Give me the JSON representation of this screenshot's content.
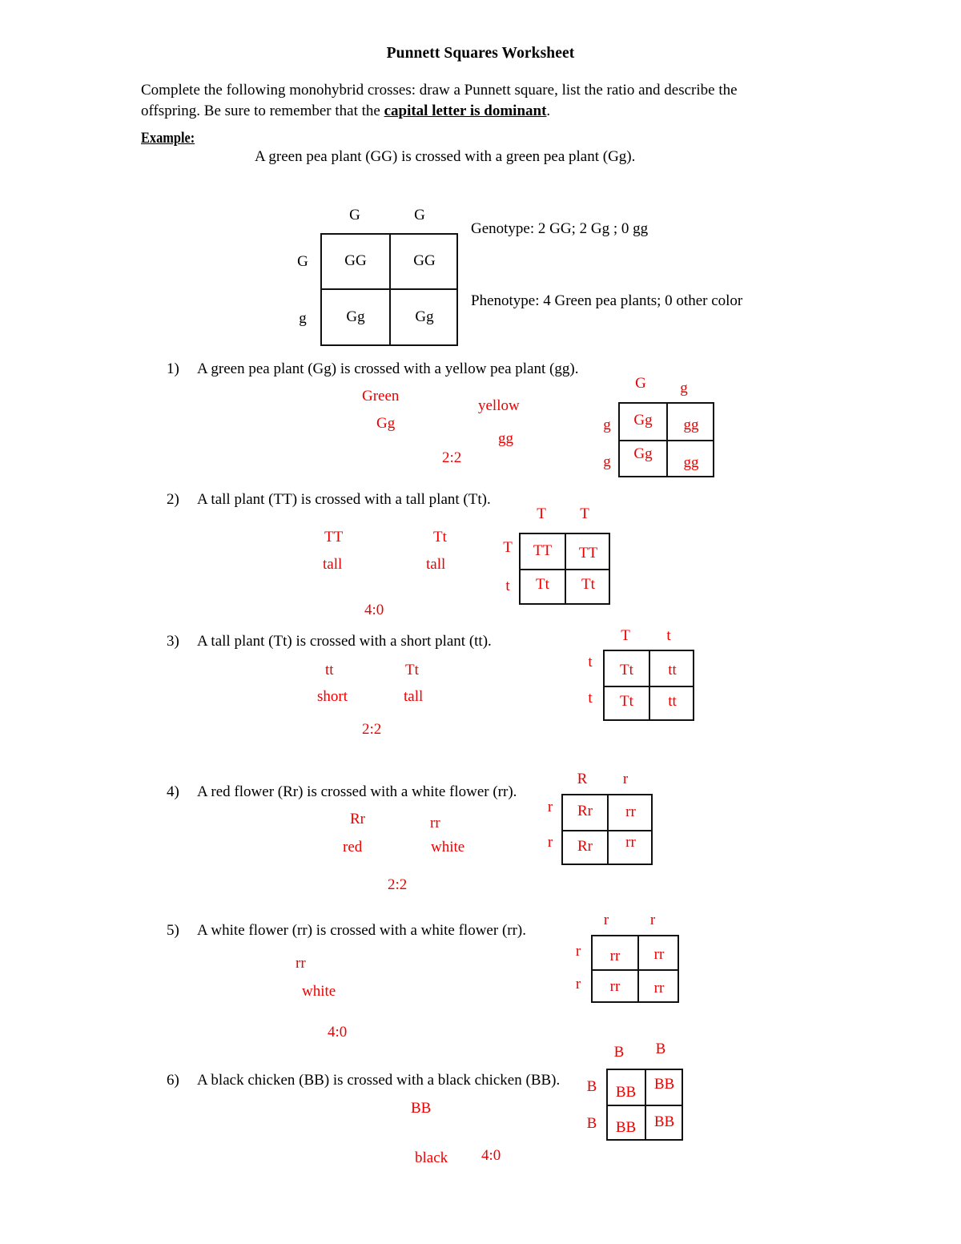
{
  "document": {
    "title": "Punnett Squares Worksheet",
    "instructions_part1": "Complete the following monohybrid crosses:  draw a Punnett square, list the ratio and describe the offspring.  Be sure to remember that the ",
    "instructions_bold": "capital letter is dominant",
    "instructions_part3": ".",
    "example_label": "Example:",
    "example_prompt": "A green pea plant (GG) is crossed with a green pea plant (Gg)."
  },
  "example": {
    "grid": {
      "top_labels": [
        "G",
        "G"
      ],
      "side_labels": [
        "G",
        "g"
      ],
      "cells": [
        [
          "GG",
          "GG"
        ],
        [
          "Gg",
          "Gg"
        ]
      ]
    },
    "genotype": "Genotype:  2 GG; 2 Gg ; 0 gg",
    "phenotype": "Phenotype: 4 Green pea plants; 0 other color"
  },
  "questions": [
    {
      "marker": "1)",
      "prompt": "A green pea plant (Gg) is crossed with a yellow pea plant (gg).",
      "answers": {
        "parent1_phenotype": "Green",
        "parent1_genotype": "Gg",
        "parent2_phenotype": "yellow",
        "parent2_genotype": "gg",
        "ratio": "2:2"
      },
      "grid": {
        "top_labels": [
          "G",
          "g"
        ],
        "side_labels": [
          "g",
          "g"
        ],
        "cells": [
          [
            "Gg",
            "gg"
          ],
          [
            "Gg",
            "gg"
          ]
        ]
      }
    },
    {
      "marker": "2)",
      "prompt": "A tall plant (TT) is crossed with a tall plant (Tt).",
      "answers": {
        "parent1_genotype": "TT",
        "parent1_phenotype": "tall",
        "parent2_genotype": "Tt",
        "parent2_phenotype": "tall",
        "ratio": "4:0"
      },
      "grid": {
        "top_labels": [
          "T",
          "T"
        ],
        "side_labels": [
          "T",
          "t"
        ],
        "cells": [
          [
            "TT",
            "TT"
          ],
          [
            "Tt",
            "Tt"
          ]
        ]
      }
    },
    {
      "marker": "3)",
      "prompt": "A tall plant (Tt) is crossed with a short plant (tt).",
      "answers": {
        "parent1_genotype": "tt",
        "parent1_phenotype": "short",
        "parent2_genotype": "Tt",
        "parent2_phenotype": "tall",
        "ratio": "2:2"
      },
      "grid": {
        "top_labels": [
          "T",
          "t"
        ],
        "side_labels": [
          "t",
          "t"
        ],
        "cells": [
          [
            "Tt",
            "tt"
          ],
          [
            "Tt",
            "tt"
          ]
        ]
      }
    },
    {
      "marker": "4)",
      "prompt": "A red flower (Rr) is crossed with a white flower (rr).",
      "answers": {
        "parent1_genotype": "Rr",
        "parent1_phenotype": "red",
        "parent2_genotype": "rr",
        "parent2_phenotype": "white",
        "ratio": "2:2"
      },
      "grid": {
        "top_labels": [
          "R",
          "r"
        ],
        "side_labels": [
          "r",
          "r"
        ],
        "cells": [
          [
            "Rr",
            "rr"
          ],
          [
            "Rr",
            "rr"
          ]
        ]
      }
    },
    {
      "marker": "5)",
      "prompt": "A white flower (rr) is crossed with a white flower (rr).",
      "answers": {
        "parent1_genotype": "rr",
        "parent1_phenotype": "white",
        "ratio": "4:0"
      },
      "grid": {
        "top_labels": [
          "r",
          "r"
        ],
        "side_labels": [
          "r",
          "r"
        ],
        "cells": [
          [
            "rr",
            "rr"
          ],
          [
            "rr",
            "rr"
          ]
        ]
      }
    },
    {
      "marker": "6)",
      "prompt": "A black chicken (BB) is crossed with a black chicken (BB).",
      "answers": {
        "parent1_genotype": "BB",
        "parent1_phenotype": "black",
        "ratio": "4:0"
      },
      "grid": {
        "top_labels": [
          "B",
          "B"
        ],
        "side_labels": [
          "B",
          "B"
        ],
        "cells": [
          [
            "BB",
            "BB"
          ],
          [
            "BB",
            "BB"
          ]
        ]
      }
    }
  ],
  "colors": {
    "ink_black": "#111111",
    "student_red": "#ee0000",
    "page_background": "#ffffff"
  }
}
